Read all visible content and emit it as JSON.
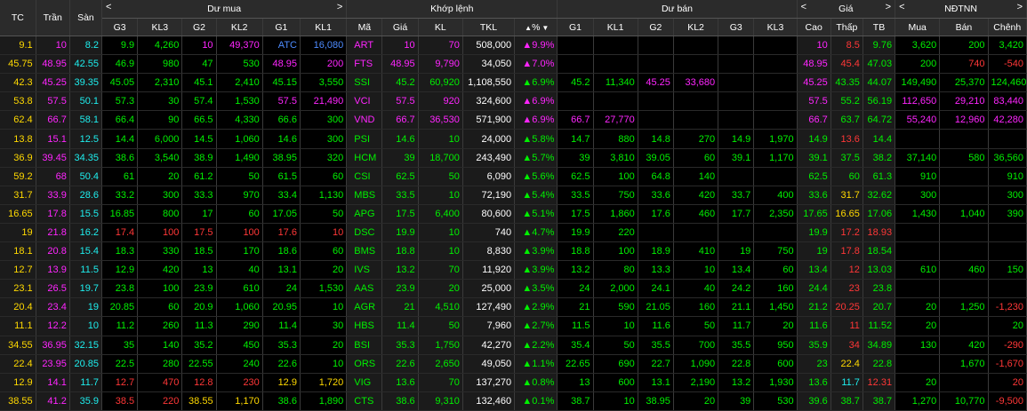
{
  "colors": {
    "ceiling": "#ff25ff",
    "floor": "#1eeeee",
    "up": "#00f000",
    "down": "#ff3737",
    "reference": "#ffd900",
    "neutral": "#ffffff"
  },
  "headers": {
    "tc": "TC",
    "tran": "Trần",
    "san": "Sàn",
    "group_buy": "Dư mua",
    "group_match": "Khớp lệnh",
    "group_sell": "Dư bán",
    "group_price": "Giá",
    "group_foreign": "NĐTNN",
    "buy_cols": [
      "G3",
      "KL3",
      "G2",
      "KL2",
      "G1",
      "KL1"
    ],
    "match_cols": [
      "Mã",
      "Giá",
      "KL",
      "TKL",
      "%"
    ],
    "sell_cols": [
      "G1",
      "KL1",
      "G2",
      "KL2",
      "G3",
      "KL3"
    ],
    "price_cols": [
      "Cao",
      "Thấp",
      "TB"
    ],
    "foreign_cols": [
      "Mua",
      "Bán",
      "Chênh"
    ],
    "arrow_left": "<",
    "arrow_right": ">",
    "sort_up": "▲",
    "sort_down": "▼"
  },
  "rows": [
    {
      "tc": "9.1",
      "tran": "10",
      "san": "8.2",
      "b3": [
        "9.9",
        "4,260",
        "up"
      ],
      "b2": [
        "10",
        "49,370",
        "ce"
      ],
      "b1": [
        "ATC",
        "16,080",
        "blue"
      ],
      "sym": "ART",
      "price": "10",
      "vol": "70",
      "tkl": "508,000",
      "pct": "▲9.9%",
      "mc": "ce",
      "s1": [
        "",
        "",
        ""
      ],
      "s2": [
        "",
        "",
        ""
      ],
      "s3": [
        "",
        "",
        ""
      ],
      "hi": [
        "10",
        "ce"
      ],
      "lo": [
        "8.5",
        "dn"
      ],
      "avg": [
        "9.76",
        "up"
      ],
      "f": [
        "3,620",
        "200",
        "3,420"
      ],
      "fc": "up"
    },
    {
      "tc": "45.75",
      "tran": "48.95",
      "san": "42.55",
      "b3": [
        "46.9",
        "980",
        "up"
      ],
      "b2": [
        "47",
        "530",
        "up"
      ],
      "b1": [
        "48.95",
        "200",
        "ce"
      ],
      "sym": "FTS",
      "price": "48.95",
      "vol": "9,790",
      "tkl": "34,050",
      "pct": "▲7.0%",
      "mc": "ce",
      "s1": [
        "",
        "",
        ""
      ],
      "s2": [
        "",
        "",
        ""
      ],
      "s3": [
        "",
        "",
        ""
      ],
      "hi": [
        "48.95",
        "ce"
      ],
      "lo": [
        "45.4",
        "dn"
      ],
      "avg": [
        "47.03",
        "up"
      ],
      "f": [
        "200",
        "740",
        "-540"
      ],
      "fc": "dnb"
    },
    {
      "tc": "42.3",
      "tran": "45.25",
      "san": "39.35",
      "b3": [
        "45.05",
        "2,310",
        "up"
      ],
      "b2": [
        "45.1",
        "2,410",
        "up"
      ],
      "b1": [
        "45.15",
        "3,550",
        "up"
      ],
      "sym": "SSI",
      "price": "45.2",
      "vol": "60,920",
      "tkl": "1,108,550",
      "pct": "▲6.9%",
      "mc": "up",
      "s1": [
        "45.2",
        "11,340",
        "up"
      ],
      "s2": [
        "45.25",
        "33,680",
        "ce"
      ],
      "s3": [
        "",
        "",
        ""
      ],
      "hi": [
        "45.25",
        "ce"
      ],
      "lo": [
        "43.35",
        "up"
      ],
      "avg": [
        "44.07",
        "up"
      ],
      "f": [
        "149,490",
        "25,370",
        "124,460"
      ],
      "fc": "up"
    },
    {
      "tc": "53.8",
      "tran": "57.5",
      "san": "50.1",
      "b3": [
        "57.3",
        "30",
        "up"
      ],
      "b2": [
        "57.4",
        "1,530",
        "up"
      ],
      "b1": [
        "57.5",
        "21,490",
        "ce"
      ],
      "sym": "VCI",
      "price": "57.5",
      "vol": "920",
      "tkl": "324,600",
      "pct": "▲6.9%",
      "mc": "ce",
      "s1": [
        "",
        "",
        ""
      ],
      "s2": [
        "",
        "",
        ""
      ],
      "s3": [
        "",
        "",
        ""
      ],
      "hi": [
        "57.5",
        "ce"
      ],
      "lo": [
        "55.2",
        "up"
      ],
      "avg": [
        "56.19",
        "up"
      ],
      "f": [
        "112,650",
        "29,210",
        "83,440"
      ],
      "fc": "ce"
    },
    {
      "tc": "62.4",
      "tran": "66.7",
      "san": "58.1",
      "b3": [
        "66.4",
        "90",
        "up"
      ],
      "b2": [
        "66.5",
        "4,330",
        "up"
      ],
      "b1": [
        "66.6",
        "300",
        "up"
      ],
      "sym": "VND",
      "price": "66.7",
      "vol": "36,530",
      "tkl": "571,900",
      "pct": "▲6.9%",
      "mc": "ce",
      "s1": [
        "66.7",
        "27,770",
        "ce"
      ],
      "s2": [
        "",
        "",
        ""
      ],
      "s3": [
        "",
        "",
        ""
      ],
      "hi": [
        "66.7",
        "ce"
      ],
      "lo": [
        "63.7",
        "up"
      ],
      "avg": [
        "64.72",
        "up"
      ],
      "f": [
        "55,240",
        "12,960",
        "42,280"
      ],
      "fc": "ce"
    },
    {
      "tc": "13.8",
      "tran": "15.1",
      "san": "12.5",
      "b3": [
        "14.4",
        "6,000",
        "up"
      ],
      "b2": [
        "14.5",
        "1,060",
        "up"
      ],
      "b1": [
        "14.6",
        "300",
        "up"
      ],
      "sym": "PSI",
      "price": "14.6",
      "vol": "10",
      "tkl": "24,000",
      "pct": "▲5.8%",
      "mc": "up",
      "s1": [
        "14.7",
        "880",
        "up"
      ],
      "s2": [
        "14.8",
        "270",
        "up"
      ],
      "s3": [
        "14.9",
        "1,970",
        "up"
      ],
      "hi": [
        "14.9",
        "up"
      ],
      "lo": [
        "13.6",
        "dn"
      ],
      "avg": [
        "14.4",
        "up"
      ],
      "f": [
        "",
        "",
        ""
      ],
      "fc": "up"
    },
    {
      "tc": "36.9",
      "tran": "39.45",
      "san": "34.35",
      "b3": [
        "38.6",
        "3,540",
        "up"
      ],
      "b2": [
        "38.9",
        "1,490",
        "up"
      ],
      "b1": [
        "38.95",
        "320",
        "up"
      ],
      "sym": "HCM",
      "price": "39",
      "vol": "18,700",
      "tkl": "243,490",
      "pct": "▲5.7%",
      "mc": "up",
      "s1": [
        "39",
        "3,810",
        "up"
      ],
      "s2": [
        "39.05",
        "60",
        "up"
      ],
      "s3": [
        "39.1",
        "1,170",
        "up"
      ],
      "hi": [
        "39.1",
        "up"
      ],
      "lo": [
        "37.5",
        "up"
      ],
      "avg": [
        "38.2",
        "up"
      ],
      "f": [
        "37,140",
        "580",
        "36,560"
      ],
      "fc": "up"
    },
    {
      "tc": "59.2",
      "tran": "68",
      "san": "50.4",
      "b3": [
        "61",
        "20",
        "up"
      ],
      "b2": [
        "61.2",
        "50",
        "up"
      ],
      "b1": [
        "61.5",
        "60",
        "up"
      ],
      "sym": "CSI",
      "price": "62.5",
      "vol": "50",
      "tkl": "6,090",
      "pct": "▲5.6%",
      "mc": "up",
      "s1": [
        "62.5",
        "100",
        "up"
      ],
      "s2": [
        "64.8",
        "140",
        "up"
      ],
      "s3": [
        "",
        "",
        ""
      ],
      "hi": [
        "62.5",
        "up"
      ],
      "lo": [
        "60",
        "up"
      ],
      "avg": [
        "61.3",
        "up"
      ],
      "f": [
        "910",
        "",
        "910"
      ],
      "fc": "up"
    },
    {
      "tc": "31.7",
      "tran": "33.9",
      "san": "28.6",
      "b3": [
        "33.2",
        "300",
        "up"
      ],
      "b2": [
        "33.3",
        "970",
        "up"
      ],
      "b1": [
        "33.4",
        "1,130",
        "up"
      ],
      "sym": "MBS",
      "price": "33.5",
      "vol": "10",
      "tkl": "72,190",
      "pct": "▲5.4%",
      "mc": "up",
      "s1": [
        "33.5",
        "750",
        "up"
      ],
      "s2": [
        "33.6",
        "420",
        "up"
      ],
      "s3": [
        "33.7",
        "400",
        "up"
      ],
      "hi": [
        "33.6",
        "up"
      ],
      "lo": [
        "31.7",
        "ref"
      ],
      "avg": [
        "32.62",
        "up"
      ],
      "f": [
        "300",
        "",
        "300"
      ],
      "fc": "up"
    },
    {
      "tc": "16.65",
      "tran": "17.8",
      "san": "15.5",
      "b3": [
        "16.85",
        "800",
        "up"
      ],
      "b2": [
        "17",
        "60",
        "up"
      ],
      "b1": [
        "17.05",
        "50",
        "up"
      ],
      "sym": "APG",
      "price": "17.5",
      "vol": "6,400",
      "tkl": "80,600",
      "pct": "▲5.1%",
      "mc": "up",
      "s1": [
        "17.5",
        "1,860",
        "up"
      ],
      "s2": [
        "17.6",
        "460",
        "up"
      ],
      "s3": [
        "17.7",
        "2,350",
        "up"
      ],
      "hi": [
        "17.65",
        "up"
      ],
      "lo": [
        "16.65",
        "ref"
      ],
      "avg": [
        "17.06",
        "up"
      ],
      "f": [
        "1,430",
        "1,040",
        "390"
      ],
      "fc": "up"
    },
    {
      "tc": "19",
      "tran": "21.8",
      "san": "16.2",
      "b3": [
        "17.4",
        "100",
        "dn"
      ],
      "b2": [
        "17.5",
        "100",
        "dn"
      ],
      "b1": [
        "17.6",
        "10",
        "dn"
      ],
      "sym": "DSC",
      "price": "19.9",
      "vol": "10",
      "tkl": "740",
      "pct": "▲4.7%",
      "mc": "up",
      "s1": [
        "19.9",
        "220",
        "up"
      ],
      "s2": [
        "",
        "",
        ""
      ],
      "s3": [
        "",
        "",
        ""
      ],
      "hi": [
        "19.9",
        "up"
      ],
      "lo": [
        "17.2",
        "dn"
      ],
      "avg": [
        "18.93",
        "dn"
      ],
      "f": [
        "",
        "",
        ""
      ],
      "fc": "up"
    },
    {
      "tc": "18.1",
      "tran": "20.8",
      "san": "15.4",
      "b3": [
        "18.3",
        "330",
        "up"
      ],
      "b2": [
        "18.5",
        "170",
        "up"
      ],
      "b1": [
        "18.6",
        "60",
        "up"
      ],
      "sym": "BMS",
      "price": "18.8",
      "vol": "10",
      "tkl": "8,830",
      "pct": "▲3.9%",
      "mc": "up",
      "s1": [
        "18.8",
        "100",
        "up"
      ],
      "s2": [
        "18.9",
        "410",
        "up"
      ],
      "s3": [
        "19",
        "750",
        "up"
      ],
      "hi": [
        "19",
        "up"
      ],
      "lo": [
        "17.8",
        "dn"
      ],
      "avg": [
        "18.54",
        "up"
      ],
      "f": [
        "",
        "",
        ""
      ],
      "fc": "up"
    },
    {
      "tc": "12.7",
      "tran": "13.9",
      "san": "11.5",
      "b3": [
        "12.9",
        "420",
        "up"
      ],
      "b2": [
        "13",
        "40",
        "up"
      ],
      "b1": [
        "13.1",
        "20",
        "up"
      ],
      "sym": "IVS",
      "price": "13.2",
      "vol": "70",
      "tkl": "11,920",
      "pct": "▲3.9%",
      "mc": "up",
      "s1": [
        "13.2",
        "80",
        "up"
      ],
      "s2": [
        "13.3",
        "10",
        "up"
      ],
      "s3": [
        "13.4",
        "60",
        "up"
      ],
      "hi": [
        "13.4",
        "up"
      ],
      "lo": [
        "12",
        "dn"
      ],
      "avg": [
        "13.03",
        "up"
      ],
      "f": [
        "610",
        "460",
        "150"
      ],
      "fc": "up"
    },
    {
      "tc": "23.1",
      "tran": "26.5",
      "san": "19.7",
      "b3": [
        "23.8",
        "100",
        "up"
      ],
      "b2": [
        "23.9",
        "610",
        "up"
      ],
      "b1": [
        "24",
        "1,530",
        "up"
      ],
      "sym": "AAS",
      "price": "23.9",
      "vol": "20",
      "tkl": "25,000",
      "pct": "▲3.5%",
      "mc": "up",
      "s1": [
        "24",
        "2,000",
        "up"
      ],
      "s2": [
        "24.1",
        "40",
        "up"
      ],
      "s3": [
        "24.2",
        "160",
        "up"
      ],
      "hi": [
        "24.4",
        "up"
      ],
      "lo": [
        "23",
        "dn"
      ],
      "avg": [
        "23.8",
        "up"
      ],
      "f": [
        "",
        "",
        ""
      ],
      "fc": "up"
    },
    {
      "tc": "20.4",
      "tran": "23.4",
      "san": "19",
      "b3": [
        "20.85",
        "60",
        "up"
      ],
      "b2": [
        "20.9",
        "1,060",
        "up"
      ],
      "b1": [
        "20.95",
        "10",
        "up"
      ],
      "sym": "AGR",
      "price": "21",
      "vol": "4,510",
      "tkl": "127,490",
      "pct": "▲2.9%",
      "mc": "up",
      "s1": [
        "21",
        "590",
        "up"
      ],
      "s2": [
        "21.05",
        "160",
        "up"
      ],
      "s3": [
        "21.1",
        "1,450",
        "up"
      ],
      "hi": [
        "21.2",
        "up"
      ],
      "lo": [
        "20.25",
        "dn"
      ],
      "avg": [
        "20.7",
        "up"
      ],
      "f": [
        "20",
        "1,250",
        "-1,230"
      ],
      "fc": "up"
    },
    {
      "tc": "11.1",
      "tran": "12.2",
      "san": "10",
      "b3": [
        "11.2",
        "260",
        "up"
      ],
      "b2": [
        "11.3",
        "290",
        "up"
      ],
      "b1": [
        "11.4",
        "30",
        "up"
      ],
      "sym": "HBS",
      "price": "11.4",
      "vol": "50",
      "tkl": "7,960",
      "pct": "▲2.7%",
      "mc": "up",
      "s1": [
        "11.5",
        "10",
        "up"
      ],
      "s2": [
        "11.6",
        "50",
        "up"
      ],
      "s3": [
        "11.7",
        "20",
        "up"
      ],
      "hi": [
        "11.6",
        "up"
      ],
      "lo": [
        "11",
        "dn"
      ],
      "avg": [
        "11.52",
        "up"
      ],
      "f": [
        "20",
        "",
        "20"
      ],
      "fc": "up"
    },
    {
      "tc": "34.55",
      "tran": "36.95",
      "san": "32.15",
      "b3": [
        "35",
        "140",
        "up"
      ],
      "b2": [
        "35.2",
        "450",
        "up"
      ],
      "b1": [
        "35.3",
        "20",
        "up"
      ],
      "sym": "BSI",
      "price": "35.3",
      "vol": "1,750",
      "tkl": "42,270",
      "pct": "▲2.2%",
      "mc": "up",
      "s1": [
        "35.4",
        "50",
        "up"
      ],
      "s2": [
        "35.5",
        "700",
        "up"
      ],
      "s3": [
        "35.5",
        "950",
        "up"
      ],
      "hi": [
        "35.9",
        "up"
      ],
      "lo": [
        "34",
        "dn"
      ],
      "avg": [
        "34.89",
        "up"
      ],
      "f": [
        "130",
        "420",
        "-290"
      ],
      "fc": "up"
    },
    {
      "tc": "22.4",
      "tran": "23.95",
      "san": "20.85",
      "b3": [
        "22.5",
        "280",
        "up"
      ],
      "b2": [
        "22.55",
        "240",
        "up"
      ],
      "b1": [
        "22.6",
        "10",
        "up"
      ],
      "sym": "ORS",
      "price": "22.6",
      "vol": "2,650",
      "tkl": "49,050",
      "pct": "▲1.1%",
      "mc": "up",
      "s1": [
        "22.65",
        "690",
        "up"
      ],
      "s2": [
        "22.7",
        "1,090",
        "up"
      ],
      "s3": [
        "22.8",
        "600",
        "up"
      ],
      "hi": [
        "23",
        "up"
      ],
      "lo": [
        "22.4",
        "ref"
      ],
      "avg": [
        "22.8",
        "up"
      ],
      "f": [
        "",
        "1,670",
        "-1,670"
      ],
      "fc": "up"
    },
    {
      "tc": "12.9",
      "tran": "14.1",
      "san": "11.7",
      "b3": [
        "12.7",
        "470",
        "dn"
      ],
      "b2": [
        "12.8",
        "230",
        "dn"
      ],
      "b1": [
        "12.9",
        "1,720",
        "ref"
      ],
      "sym": "VIG",
      "price": "13.6",
      "vol": "70",
      "tkl": "137,270",
      "pct": "▲0.8%",
      "mc": "up",
      "s1": [
        "13",
        "600",
        "up"
      ],
      "s2": [
        "13.1",
        "2,190",
        "up"
      ],
      "s3": [
        "13.2",
        "1,930",
        "up"
      ],
      "hi": [
        "13.6",
        "up"
      ],
      "lo": [
        "11.7",
        "fl"
      ],
      "avg": [
        "12.31",
        "dn"
      ],
      "f": [
        "20",
        "",
        "20"
      ],
      "fc": "dn"
    },
    {
      "tc": "38.55",
      "tran": "41.2",
      "san": "35.9",
      "b3": [
        "38.5",
        "220",
        "dn"
      ],
      "b2": [
        "38.55",
        "1,170",
        "ref"
      ],
      "b1": [
        "38.6",
        "1,890",
        "up"
      ],
      "sym": "CTS",
      "price": "38.6",
      "vol": "9,310",
      "tkl": "132,460",
      "pct": "▲0.1%",
      "mc": "up",
      "s1": [
        "38.7",
        "10",
        "up"
      ],
      "s2": [
        "38.95",
        "20",
        "up"
      ],
      "s3": [
        "39",
        "530",
        "up"
      ],
      "hi": [
        "39.6",
        "up"
      ],
      "lo": [
        "38.7",
        "up"
      ],
      "avg": [
        "38.7",
        "up"
      ],
      "f": [
        "1,270",
        "10,770",
        "-9,500"
      ],
      "fc": "up"
    }
  ]
}
